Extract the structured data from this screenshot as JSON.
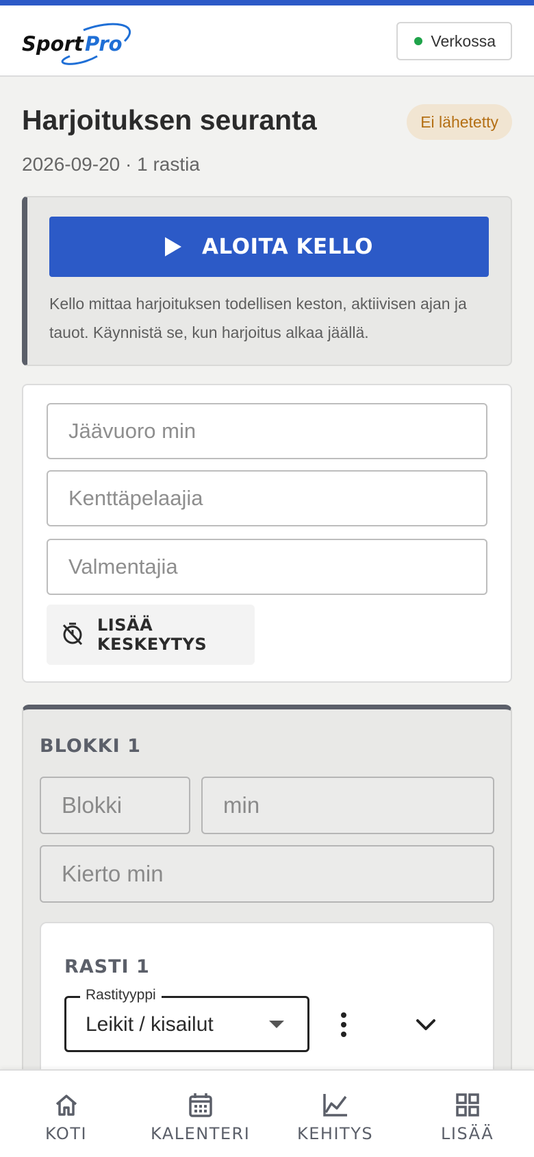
{
  "header": {
    "logo_text": "SportPro",
    "status_label": "Verkossa",
    "status_color": "#1fa34a"
  },
  "page": {
    "title": "Harjoituksen seuranta",
    "badge": "Ei lähetetty",
    "subtitle": "2026-09-20 · 1 rastia"
  },
  "clock": {
    "start_label": "ALOITA KELLO",
    "description": "Kello mittaa harjoituksen todellisen keston, aktiivisen ajan ja tauot. Käynnistä se, kun harjoitus alkaa jäällä."
  },
  "fields": {
    "ice_time_placeholder": "Jäävuoro min",
    "field_players_placeholder": "Kenttäpelaajia",
    "coaches_placeholder": "Valmentajia",
    "add_pause_label": "LISÄÄ KESKEYTYS"
  },
  "block": {
    "title": "BLOKKI 1",
    "name_placeholder": "Blokki",
    "minutes_placeholder": "min",
    "rotation_placeholder": "Kierto min",
    "station": {
      "title": "RASTI 1",
      "type_label": "Rastityyppi",
      "type_value": "Leikit / kisailut"
    }
  },
  "nav": {
    "items": [
      {
        "label": "KOTI",
        "icon": "home-icon"
      },
      {
        "label": "KALENTERI",
        "icon": "calendar-icon"
      },
      {
        "label": "KEHITYS",
        "icon": "chart-icon"
      },
      {
        "label": "LISÄÄ",
        "icon": "grid-icon"
      }
    ]
  },
  "colors": {
    "accent": "#2c5ac7",
    "badge_bg": "#f1e5d2",
    "badge_text": "#b46f14",
    "dark_accent": "#5b5f69"
  }
}
